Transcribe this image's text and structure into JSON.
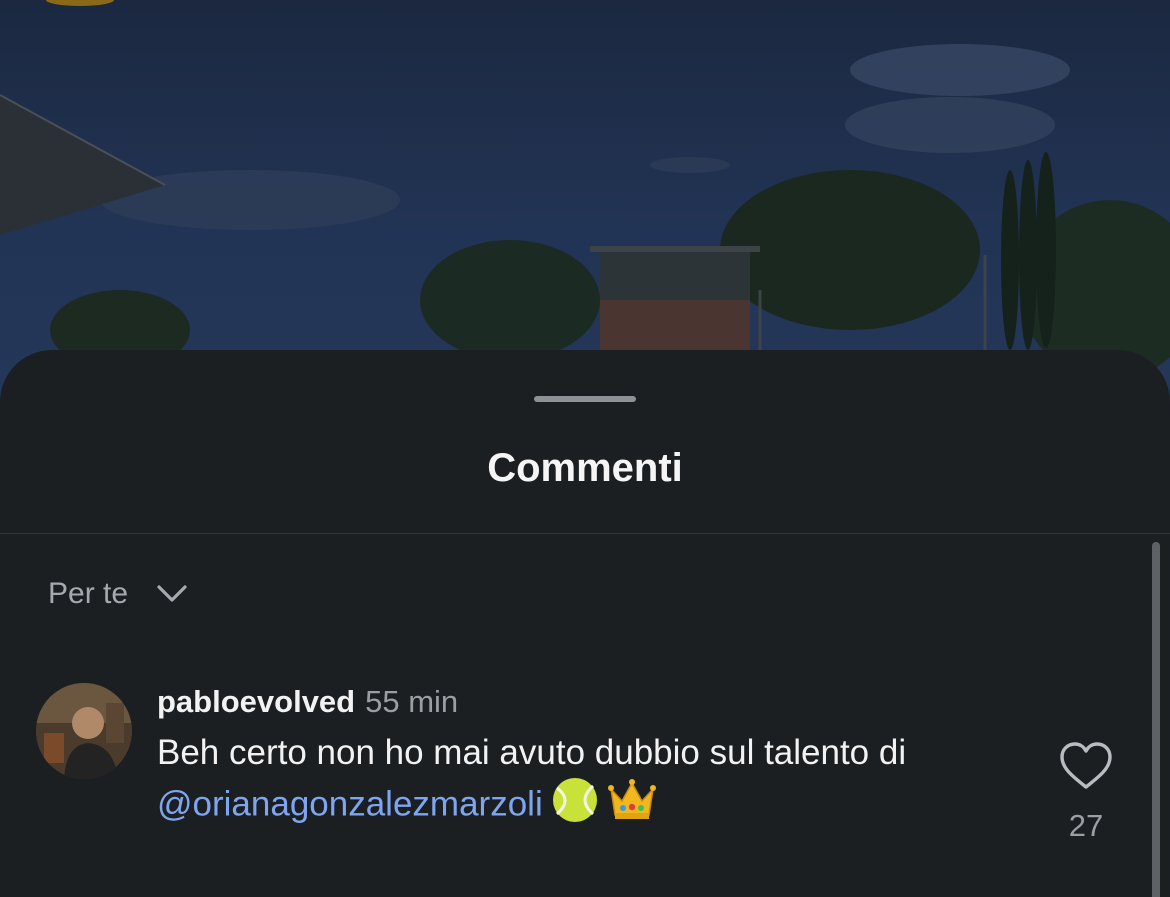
{
  "sheet": {
    "title": "Commenti",
    "sort_label": "Per te",
    "sort_icon": "chevron-down-icon"
  },
  "comments": [
    {
      "username": "pabloevolved",
      "time": "55 min",
      "text_prefix": "Beh certo non ho mai avuto dubbio sul talento di",
      "mention": "@orianagonzalezmarzoli",
      "emojis": [
        "tennis-ball-icon",
        "crown-icon"
      ],
      "like_icon": "heart-icon",
      "likes": "27"
    }
  ],
  "colors": {
    "sheet_bg": "#1c1f22",
    "mention": "#7fa5f0",
    "secondary_text": "#9b9ea3"
  }
}
